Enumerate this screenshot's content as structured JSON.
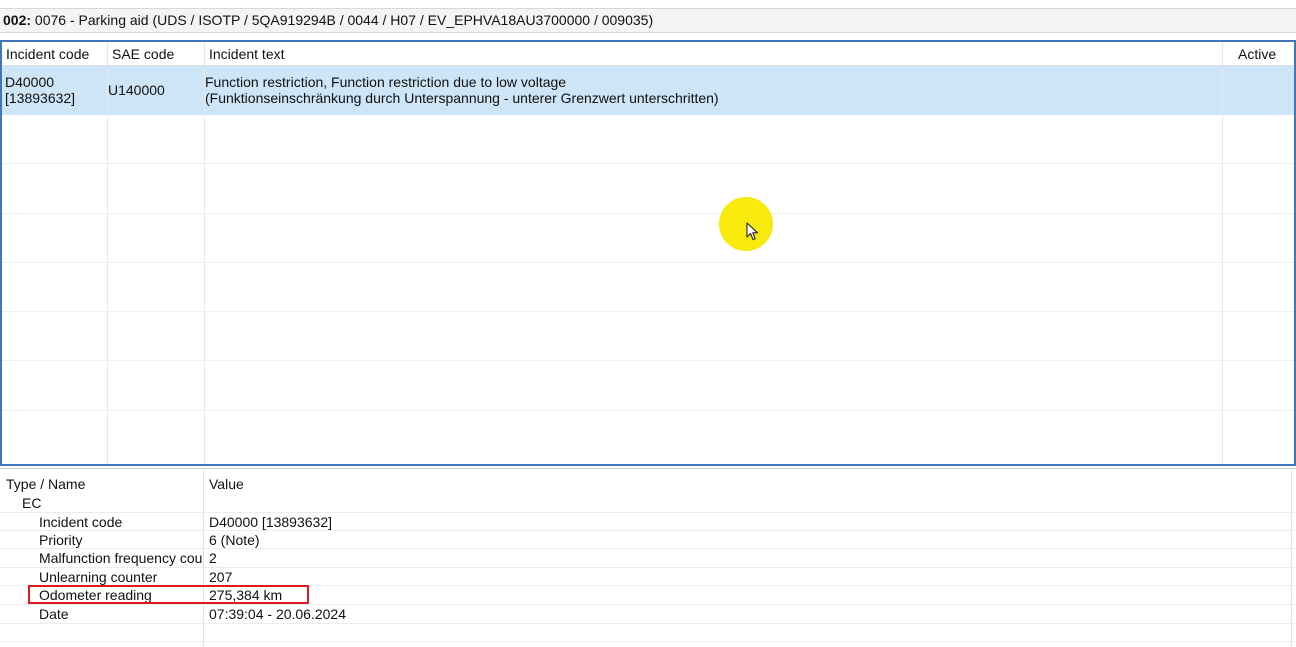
{
  "header": {
    "address": "002:",
    "module": " 0076 - Parking aid  (UDS / ISOTP / 5QA919294B / 0044 / H07 / EV_EPHVA18AU3700000 / 009035)"
  },
  "incident_table": {
    "columns": [
      "Incident code",
      "SAE code",
      "Incident text",
      "Active"
    ],
    "rows": [
      {
        "incident_code_line1": "D40000",
        "incident_code_line2": "[13893632]",
        "sae_code": "U140000",
        "text_line1": "Function restriction, Function restriction due to low voltage",
        "text_line2": "(Funktionseinschränkung durch Unterspannung - unterer Grenzwert unterschritten)",
        "active": ""
      }
    ]
  },
  "detail_table": {
    "columns": [
      "Type / Name",
      "Value"
    ],
    "group": "EC",
    "rows": [
      {
        "name": "Incident code",
        "value": "D40000 [13893632]"
      },
      {
        "name": "Priority",
        "value": "6 (Note)"
      },
      {
        "name": "Malfunction frequency coun",
        "value": "2"
      },
      {
        "name": "Unlearning counter",
        "value": "207"
      },
      {
        "name": "Odometer reading",
        "value": "275,384 km"
      },
      {
        "name": "Date",
        "value": "07:39:04 - 20.06.2024"
      }
    ]
  },
  "colors": {
    "selection": "#cde5f7",
    "panel_border": "#3f78b5",
    "highlight_box": "#e0191e",
    "cursor_highlight": "#f7ea0c"
  },
  "icons": {
    "cursor": "mouse-pointer-icon"
  }
}
